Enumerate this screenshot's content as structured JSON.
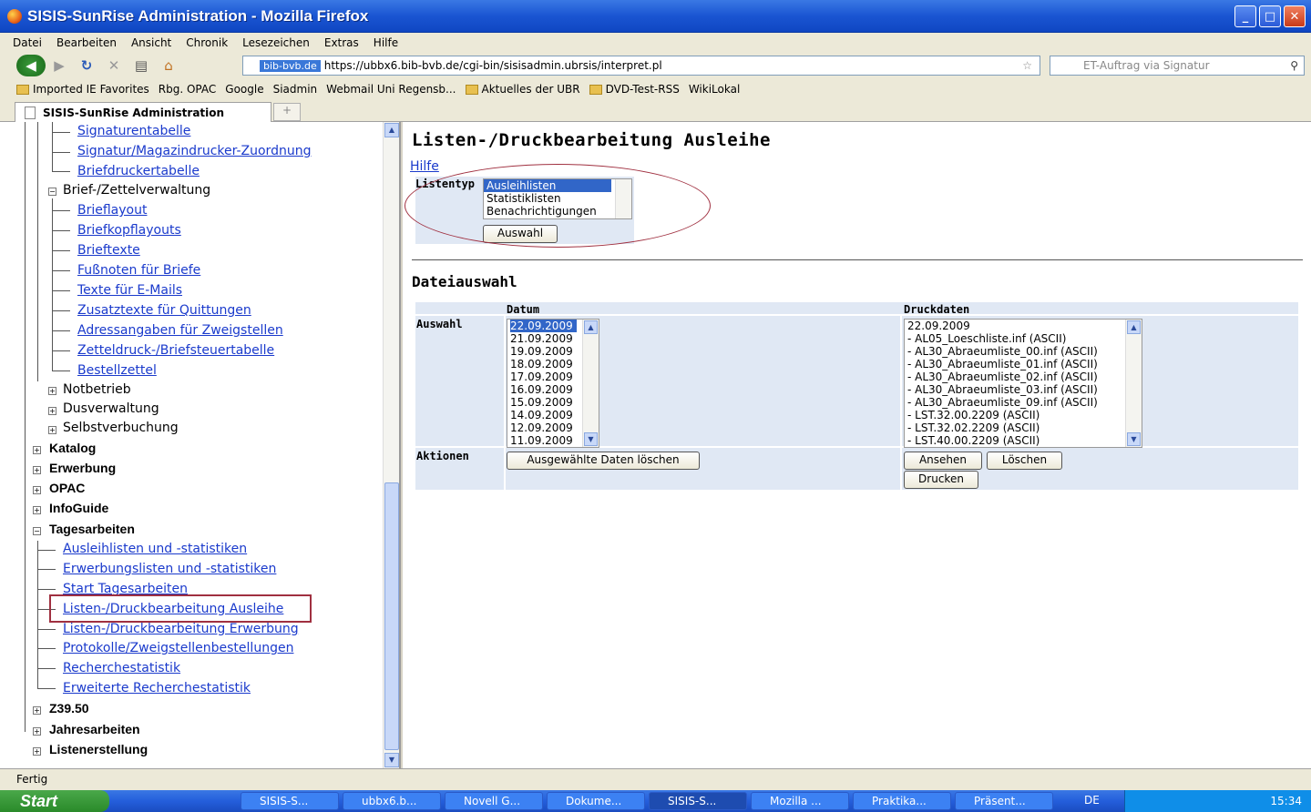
{
  "window": {
    "title": "SISIS-SunRise Administration - Mozilla Firefox"
  },
  "menu": [
    "Datei",
    "Bearbeiten",
    "Ansicht",
    "Chronik",
    "Lesezeichen",
    "Extras",
    "Hilfe"
  ],
  "navbar": {
    "site": "bib-bvb.de",
    "url": "https://ubbx6.bib-bvb.de/cgi-bin/sisisadmin.ubrsis/interpret.pl",
    "search_placeholder": "ET-Auftrag via Signatur"
  },
  "bookmarks": [
    "Imported IE Favorites",
    "Rbg. OPAC",
    "Google",
    "Siadmin",
    "Webmail Uni Regensb...",
    "Aktuelles der UBR",
    "DVD-Test-RSS",
    "WikiLokal"
  ],
  "tab": {
    "label": "SISIS-SunRise Administration"
  },
  "tree": {
    "n1": "Signaturentabelle",
    "n2": "Signatur/Magazindrucker-Zuordnung",
    "n3": "Briefdruckertabelle",
    "n4": "Brief-/Zettelverwaltung",
    "n5": "Brieflayout",
    "n6": "Briefkopflayouts",
    "n7": "Brieftexte",
    "n8": "Fußnoten für Briefe",
    "n9": "Texte für E-Mails",
    "n10": "Zusatztexte für Quittungen",
    "n11": "Adressangaben für Zweigstellen",
    "n12": "Zetteldruck-/Briefsteuertabelle",
    "n13": "Bestellzettel",
    "n14": "Notbetrieb",
    "n15": "Dusverwaltung",
    "n16": "Selbstverbuchung",
    "n17": "Katalog",
    "n18": "Erwerbung",
    "n19": "OPAC",
    "n20": "InfoGuide",
    "n21": "Tagesarbeiten",
    "n22": "Ausleihlisten und -statistiken",
    "n23": "Erwerbungslisten und -statistiken",
    "n24": "Start Tagesarbeiten",
    "n25": "Listen-/Druckbearbeitung Ausleihe",
    "n26": "Listen-/Druckbearbeitung Erwerbung",
    "n27": "Protokolle/Zweigstellenbestellungen",
    "n28": "Recherchestatistik",
    "n29": "Erweiterte Recherchestatistik",
    "n30": "Z39.50",
    "n31": "Jahresarbeiten",
    "n32": "Listenerstellung"
  },
  "main": {
    "title": "Listen-/Druckbearbeitung Ausleihe",
    "help": "Hilfe",
    "listentyp_label": "Listentyp",
    "listentyp_options": [
      "Ausleihlisten",
      "Statistiklisten",
      "Benachrichtigungen"
    ],
    "auswahl_button": "Auswahl",
    "section_title": "Dateiauswahl",
    "col_datum": "Datum",
    "col_druckdaten": "Druckdaten",
    "row_auswahl": "Auswahl",
    "row_aktionen": "Aktionen",
    "dates": [
      "22.09.2009",
      "21.09.2009",
      "19.09.2009",
      "18.09.2009",
      "17.09.2009",
      "16.09.2009",
      "15.09.2009",
      "14.09.2009",
      "12.09.2009",
      "11.09.2009"
    ],
    "druckdaten": [
      "22.09.2009",
      "- AL05_Loeschliste.inf (ASCII)",
      "- AL30_Abraeumliste_00.inf (ASCII)",
      "- AL30_Abraeumliste_01.inf (ASCII)",
      "- AL30_Abraeumliste_02.inf (ASCII)",
      "- AL30_Abraeumliste_03.inf (ASCII)",
      "- AL30_Abraeumliste_09.inf (ASCII)",
      "- LST.32.00.2209 (ASCII)",
      "- LST.32.02.2209 (ASCII)",
      "- LST.40.00.2209 (ASCII)"
    ],
    "delete_selected": "Ausgewählte Daten löschen",
    "view": "Ansehen",
    "delete": "Löschen",
    "print": "Drucken"
  },
  "status": "Fertig",
  "taskbar": {
    "start": "Start",
    "tasks": [
      "SISIS-S...",
      "ubbx6.b...",
      "Novell G...",
      "Dokume...",
      "SISIS-S...",
      "Mozilla ...",
      "Praktika...",
      "Präsent..."
    ],
    "lang": "DE",
    "time": "15:34"
  }
}
